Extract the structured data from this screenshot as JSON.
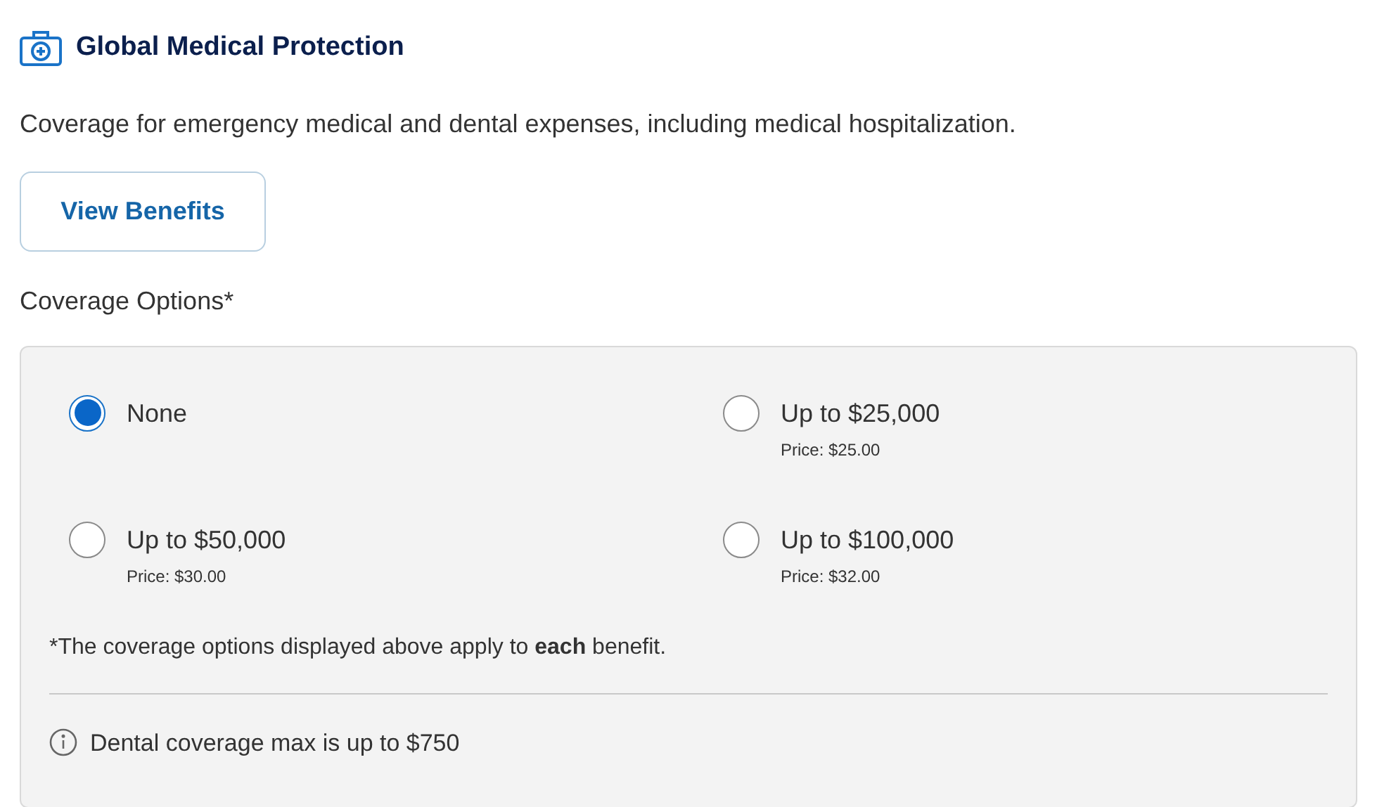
{
  "title": "Global Medical Protection",
  "description": "Coverage for emergency medical and dental expenses, including medical hospitalization.",
  "view_benefits_button": "View Benefits",
  "options_label": "Coverage Options*",
  "options": [
    {
      "label": "None",
      "selected": true
    },
    {
      "label": "Up to $25,000",
      "price": "Price: $25.00",
      "selected": false
    },
    {
      "label": "Up to $50,000",
      "price": "Price: $30.00",
      "selected": false
    },
    {
      "label": "Up to $100,000",
      "price": "Price: $32.00",
      "selected": false
    }
  ],
  "footnote": "*The coverage options displayed above apply to **each** benefit.",
  "info_note": "Dental coverage max is up to $750"
}
